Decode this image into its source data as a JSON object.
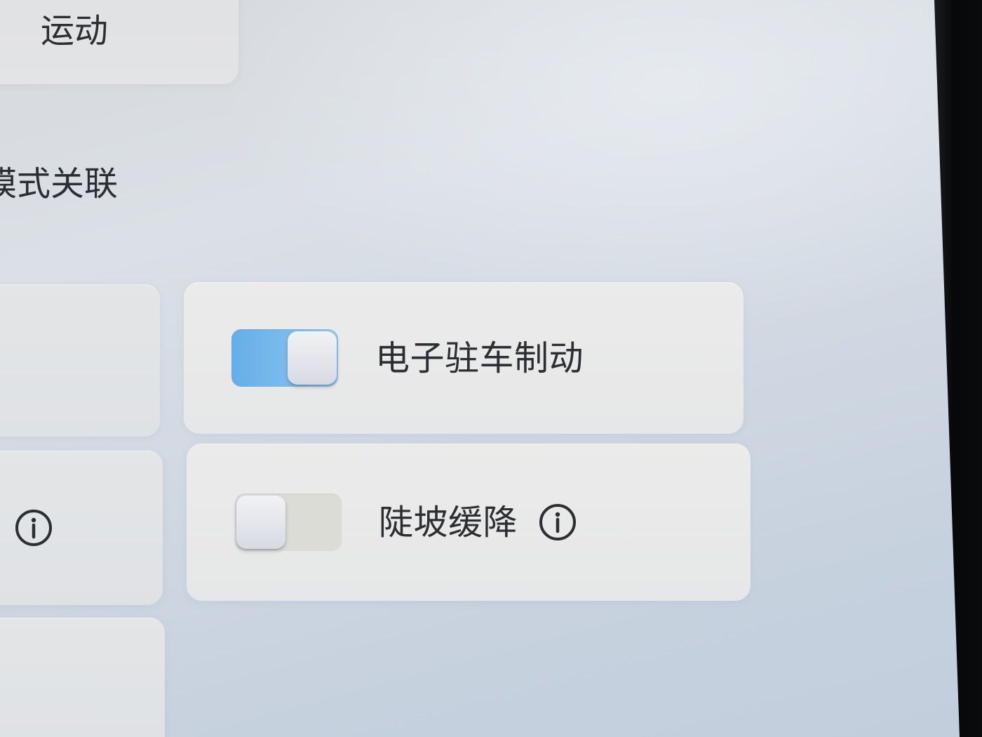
{
  "mode_card": {
    "label": "运动"
  },
  "section": {
    "title": "模式关联"
  },
  "left_column": {
    "row2_icon": "info-icon"
  },
  "settings": [
    {
      "label": "电子驻车制动",
      "enabled": true
    },
    {
      "label": "陡坡缓降",
      "enabled": false,
      "icon": "info-icon"
    }
  ],
  "colors": {
    "accent": "#72b6ea",
    "text": "#2b2e33",
    "card": "#e9eaeb",
    "bezel": "#0a0b0d",
    "toggle_off_track": "#dcdcd7"
  }
}
